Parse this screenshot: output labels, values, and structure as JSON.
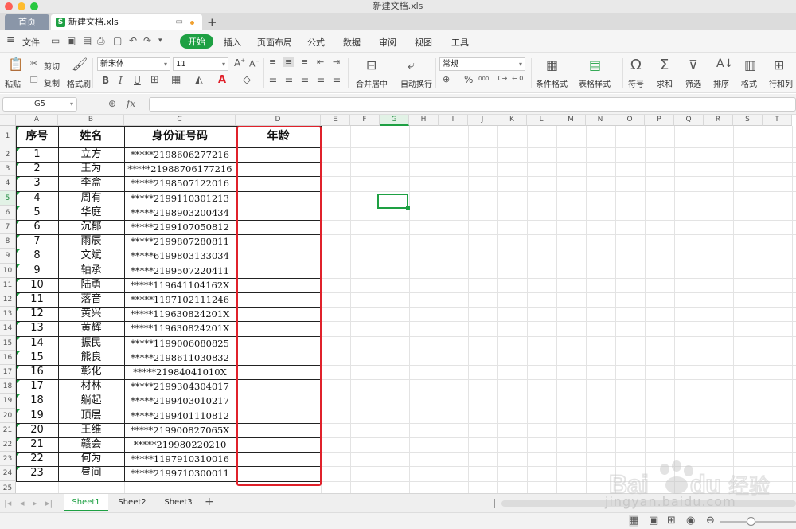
{
  "window": {
    "title": "新建文档.xls"
  },
  "tabs": {
    "home": "首页",
    "doc": "新建文档.xls",
    "add": "+"
  },
  "menu": {
    "file": "文件",
    "items": [
      "开始",
      "插入",
      "页面布局",
      "公式",
      "数据",
      "审阅",
      "视图",
      "工具"
    ],
    "active": "开始"
  },
  "toolbar": {
    "paste": "粘贴",
    "cut": "剪切",
    "copy": "复制",
    "format_painter": "格式刷",
    "font_name": "新宋体",
    "font_size": "11",
    "bold": "B",
    "italic": "I",
    "underline": "U",
    "merge_center": "合并居中",
    "wrap_text": "自动换行",
    "number_format": "常规",
    "percent": "%",
    "thousands": "000",
    "cond_format": "条件格式",
    "table_style": "表格样式",
    "symbol": "符号",
    "sum": "求和",
    "filter": "筛选",
    "sort": "排序",
    "format": "格式",
    "row_col": "行和列"
  },
  "formula_bar": {
    "cell_ref": "G5",
    "fx": "fx",
    "value": ""
  },
  "grid": {
    "columns": [
      "A",
      "B",
      "C",
      "D",
      "E",
      "F",
      "G",
      "H",
      "I",
      "J",
      "K",
      "L",
      "M",
      "N",
      "O",
      "P",
      "Q",
      "R",
      "S",
      "T"
    ],
    "row_numbers": [
      "1",
      "2",
      "3",
      "4",
      "5",
      "6",
      "7",
      "8",
      "9",
      "10",
      "11",
      "12",
      "13",
      "14",
      "15",
      "16",
      "17",
      "18",
      "19",
      "20",
      "21",
      "22",
      "23",
      "24",
      "25"
    ],
    "selected_cell": "G5",
    "header_row": [
      "序号",
      "姓名",
      "身份证号码",
      "年龄"
    ],
    "rows": [
      [
        "1",
        "立方",
        "*****2198606277216",
        ""
      ],
      [
        "2",
        "王为",
        "*****21988706177216",
        ""
      ],
      [
        "3",
        "李盒",
        "*****2198507122016",
        ""
      ],
      [
        "4",
        "周有",
        "*****2199110301213",
        ""
      ],
      [
        "5",
        "华庭",
        "*****2198903200434",
        ""
      ],
      [
        "6",
        "沉郁",
        "*****2199107050812",
        ""
      ],
      [
        "7",
        "雨辰",
        "*****2199807280811",
        ""
      ],
      [
        "8",
        "文斌",
        "*****6199803133034",
        ""
      ],
      [
        "9",
        "轴承",
        "*****2199507220411",
        ""
      ],
      [
        "10",
        "陆勇",
        "*****119641104162X",
        ""
      ],
      [
        "11",
        "落音",
        "*****1197102111246",
        ""
      ],
      [
        "12",
        "黄兴",
        "*****119630824201X",
        ""
      ],
      [
        "13",
        "黄辉",
        "*****119630824201X",
        ""
      ],
      [
        "14",
        "振民",
        "*****1199006080825",
        ""
      ],
      [
        "15",
        "熊良",
        "*****2198611030832",
        ""
      ],
      [
        "16",
        "彰化",
        "*****21984041010X",
        ""
      ],
      [
        "17",
        "材林",
        "*****2199304304017",
        ""
      ],
      [
        "18",
        "躺起",
        "*****2199403010217",
        ""
      ],
      [
        "19",
        "顶层",
        "*****2199401110812",
        ""
      ],
      [
        "20",
        "王维",
        "*****219900827065X",
        ""
      ],
      [
        "21",
        "赣会",
        "*****219980220210",
        ""
      ],
      [
        "22",
        "何为",
        "*****1197910310016",
        ""
      ],
      [
        "23",
        "昼间",
        "*****2199710300011",
        ""
      ]
    ]
  },
  "sheets": {
    "tabs": [
      "Sheet1",
      "Sheet2",
      "Sheet3"
    ],
    "active": "Sheet1",
    "add": "+"
  },
  "watermark": {
    "logo": "Bai du 经验",
    "url": "jingyan.baidu.com"
  },
  "colors": {
    "accent": "#1ea043",
    "highlight_box": "#e0212b"
  }
}
